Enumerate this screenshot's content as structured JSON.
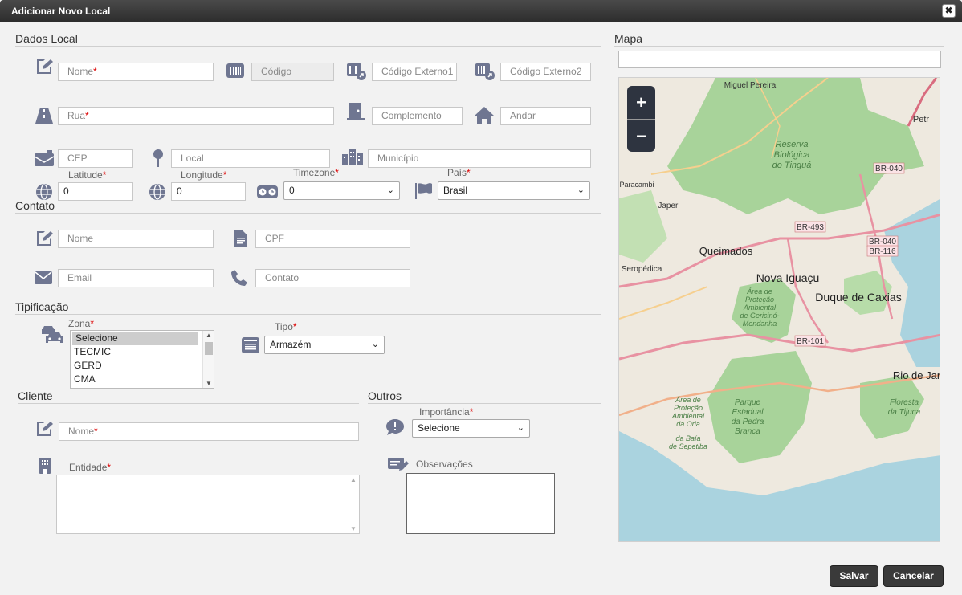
{
  "dialog": {
    "title": "Adicionar Novo Local",
    "close_glyph": "✖"
  },
  "sections": {
    "dados_local": "Dados Local",
    "mapa": "Mapa",
    "contato": "Contato",
    "tipificacao": "Tipificação",
    "cliente": "Cliente",
    "outros": "Outros"
  },
  "dados_local": {
    "nome": {
      "placeholder": "Nome",
      "req": "*"
    },
    "codigo": {
      "placeholder": "Código"
    },
    "codigo_externo1": {
      "placeholder": "Código Externo1"
    },
    "codigo_externo2": {
      "placeholder": "Código Externo2"
    },
    "rua": {
      "placeholder": "Rua",
      "req": "*"
    },
    "complemento": {
      "placeholder": "Complemento"
    },
    "andar": {
      "placeholder": "Andar"
    },
    "cep": {
      "placeholder": "CEP"
    },
    "local": {
      "placeholder": "Local"
    },
    "municipio": {
      "placeholder": "Município"
    },
    "latitude": {
      "label": "Latitude",
      "req": "*",
      "value": "0"
    },
    "longitude": {
      "label": "Longitude",
      "req": "*",
      "value": "0"
    },
    "timezone": {
      "label": "Timezone",
      "req": "*",
      "value": "0"
    },
    "pais": {
      "label": "País",
      "req": "*",
      "value": "Brasil"
    }
  },
  "contato": {
    "nome": {
      "placeholder": "Nome"
    },
    "cpf": {
      "placeholder": "CPF"
    },
    "email": {
      "placeholder": "Email"
    },
    "contato": {
      "placeholder": "Contato"
    }
  },
  "tipificacao": {
    "zona": {
      "label": "Zona",
      "req": "*",
      "options": [
        "Selecione",
        "TECMIC",
        "GERD",
        "CMA"
      ]
    },
    "tipo": {
      "label": "Tipo",
      "req": "*",
      "value": "Armazém"
    }
  },
  "cliente": {
    "nome": {
      "placeholder": "Nome",
      "req": "*"
    },
    "entidade": {
      "label": "Entidade",
      "req": "*"
    }
  },
  "outros": {
    "importancia": {
      "label": "Importância",
      "req": "*",
      "value": "Selecione"
    },
    "observacoes": {
      "label": "Observações"
    }
  },
  "map": {
    "search_placeholder": "",
    "zoom_in": "+",
    "zoom_out": "−",
    "places": [
      "Miguel Pereira",
      "Petr",
      "Reserva",
      "Biológica",
      "do Tinguá",
      "Paracambi",
      "Japeri",
      "Queimados",
      "Seropédica",
      "Nova Iguaçu",
      "Duque de Caxias",
      "Área de",
      "Proteção",
      "Ambiental",
      "de Gericinó-",
      "Mendanha",
      "Rio de Jan",
      "Área de",
      "Proteção",
      "Ambiental",
      "da Orla",
      "da Baía",
      "de Sepetiba",
      "Parque",
      "Estadual",
      "da Pedra",
      "Branca",
      "Floresta",
      "da Tijuca"
    ],
    "shields": [
      "BR-040",
      "BR-493",
      "BR-040",
      "BR-116",
      "BR-101"
    ],
    "colors": {
      "forest": "#a8d39a",
      "water": "#aad3df",
      "land": "#eee9df",
      "road": "#e892a2"
    }
  },
  "footer": {
    "save": "Salvar",
    "cancel": "Cancelar"
  }
}
